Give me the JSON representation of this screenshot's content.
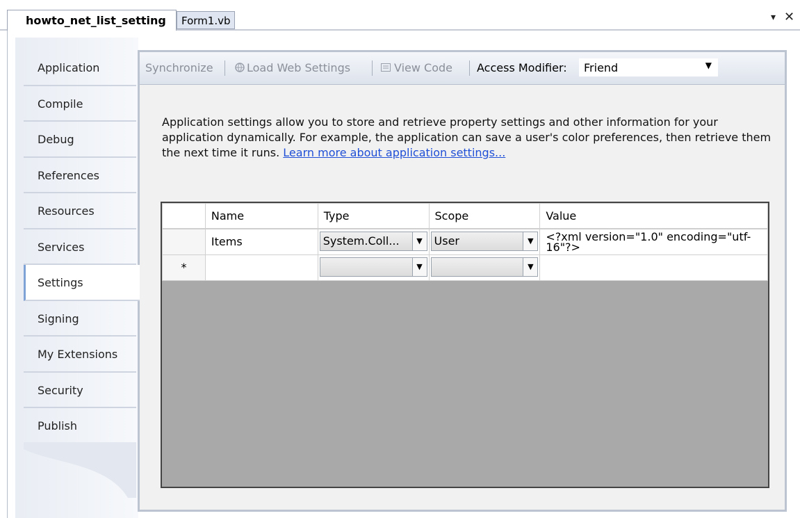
{
  "doc_tabs": {
    "active": "howto_net_list_setting",
    "inactive": "Form1.vb"
  },
  "window_controls": {
    "pin": "▾",
    "close": "✕"
  },
  "sidebar": {
    "items": [
      {
        "label": "Application"
      },
      {
        "label": "Compile"
      },
      {
        "label": "Debug"
      },
      {
        "label": "References"
      },
      {
        "label": "Resources"
      },
      {
        "label": "Services"
      },
      {
        "label": "Settings"
      },
      {
        "label": "Signing"
      },
      {
        "label": "My Extensions"
      },
      {
        "label": "Security"
      },
      {
        "label": "Publish"
      }
    ],
    "selected": "Settings"
  },
  "toolbar": {
    "synchronize": "Synchronize",
    "load_web_settings": "Load Web Settings",
    "view_code": "View Code",
    "access_modifier_label": "Access Modifier:",
    "access_modifier_value": "Friend"
  },
  "description": {
    "text": "Application settings allow you to store and retrieve property settings and other information for your application dynamically. For example, the application can save a user's color preferences, then retrieve them the next time it runs.",
    "link": "Learn more about application settings..."
  },
  "grid": {
    "columns": [
      "Name",
      "Type",
      "Scope",
      "Value"
    ],
    "rows": [
      {
        "name": "Items",
        "type": "System.Coll...",
        "scope": "User",
        "value": "<?xml version=\"1.0\" encoding=\"utf-16\"?>"
      }
    ],
    "new_row_marker": "*"
  },
  "colors": {
    "accent": "#7fa2d6",
    "link": "#1f4fd6",
    "panel_border": "#bcc4d2"
  }
}
